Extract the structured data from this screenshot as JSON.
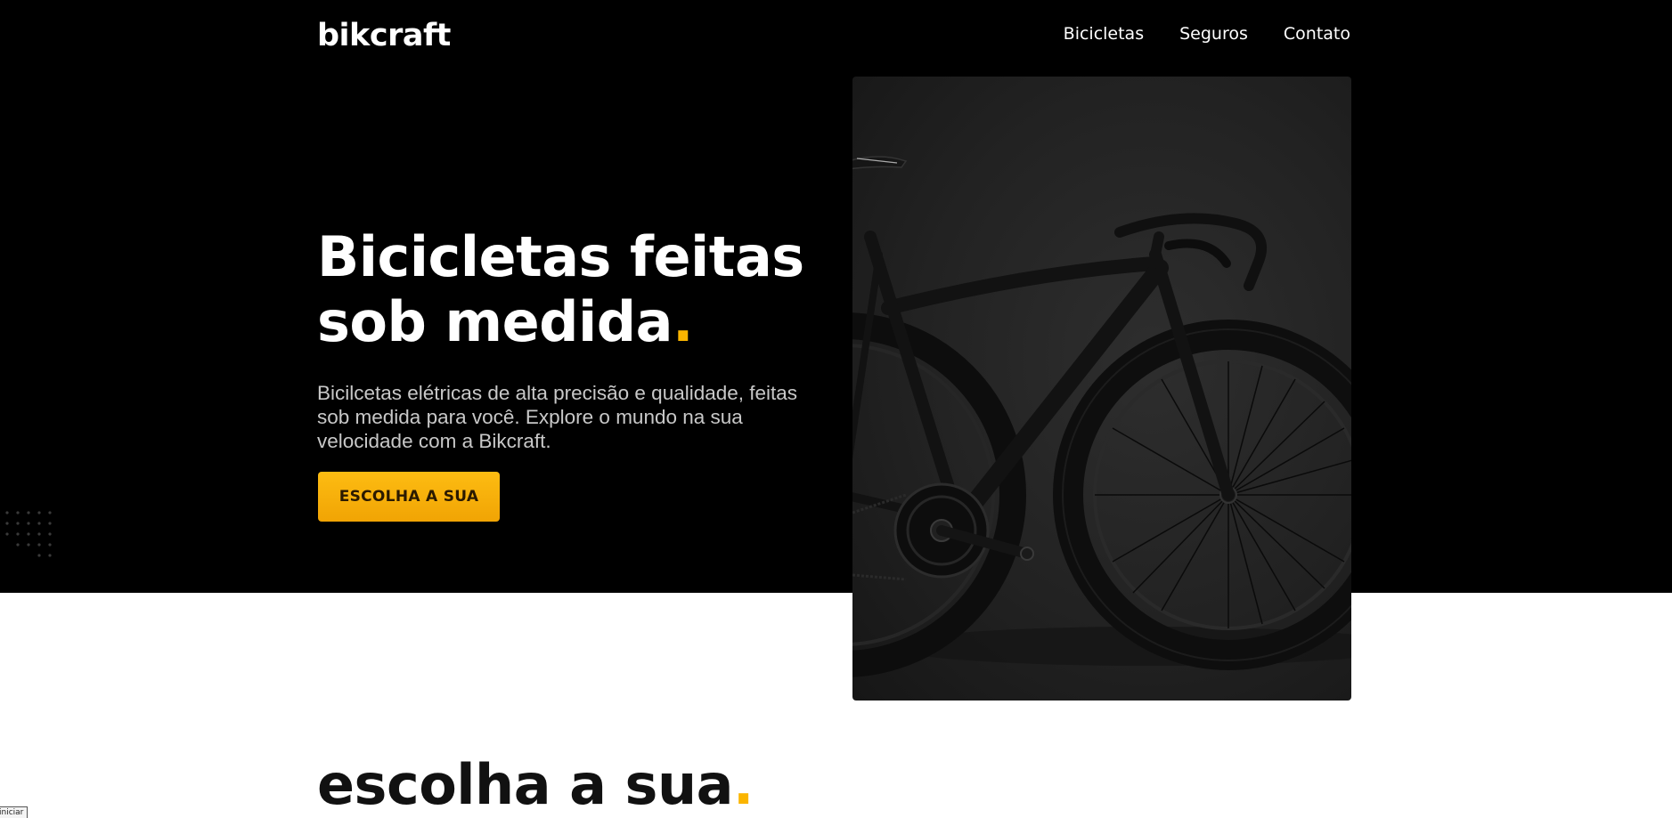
{
  "header": {
    "logo": "bikcraft",
    "nav": [
      {
        "label": "Bicicletas"
      },
      {
        "label": "Seguros"
      },
      {
        "label": "Contato"
      }
    ]
  },
  "hero": {
    "title_line1": "Bicicletas feitas",
    "title_line2": "sob medida",
    "title_dot": ".",
    "description": "Bicilcetas elétricas de alta precisão e qualidade, feitas sob medida para você. Explore o mundo na sua velocidade com a Bikcraft.",
    "cta_label": "ESCOLHA A SUA",
    "image_alt": "Bicicleta preta"
  },
  "section": {
    "title": "escolha a sua",
    "title_dot": "."
  },
  "corner_tag": "iniciar",
  "colors": {
    "accent": "#fbb500",
    "hero_bg": "#000000",
    "page_bg": "#ffffff",
    "heading_dark": "#111111"
  },
  "icons": {
    "decoration": "dot-grid-icon"
  }
}
